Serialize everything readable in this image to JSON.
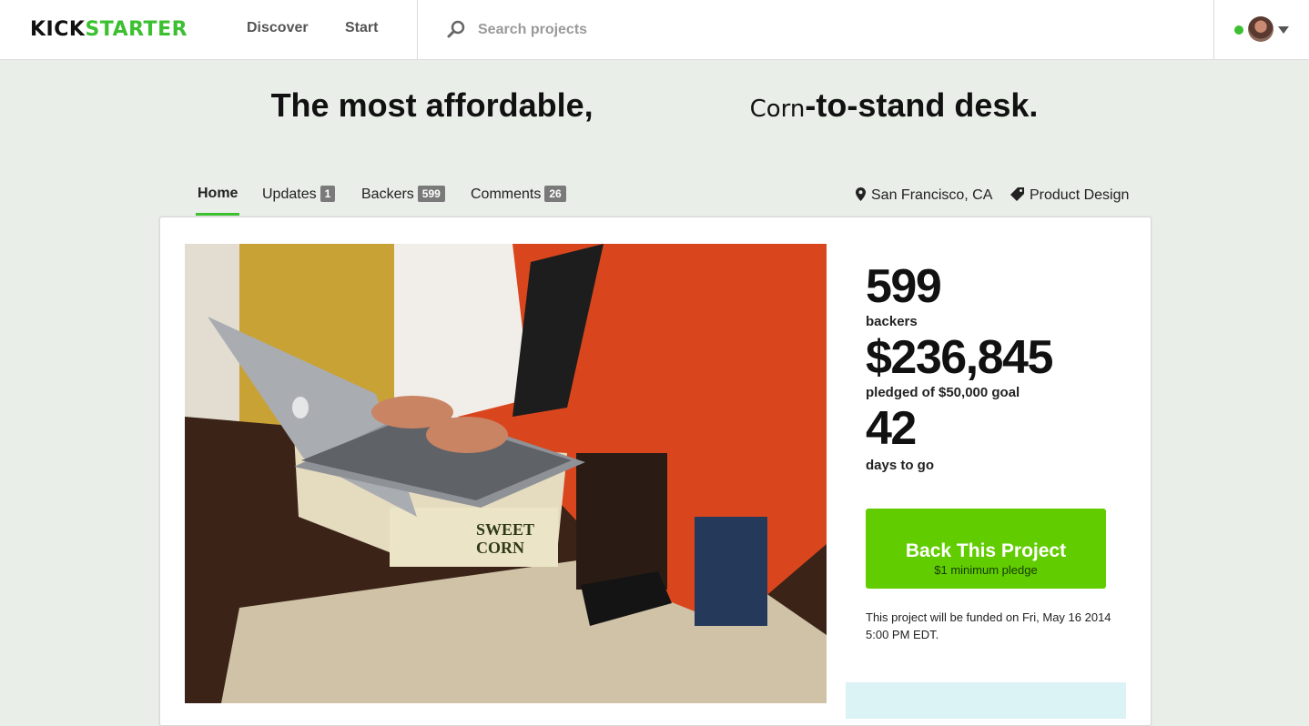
{
  "nav": {
    "logo_part1": "KICK",
    "logo_part2": "STARTER",
    "discover": "Discover",
    "start": "Start",
    "search_placeholder": "Search projects",
    "accent_color": "#3cc031"
  },
  "project": {
    "title_part1": "The most affordable,",
    "title_corn": "Corn",
    "title_part2": "-to-stand desk."
  },
  "tabs": [
    {
      "label": "Home",
      "count": ""
    },
    {
      "label": "Updates",
      "count": "1"
    },
    {
      "label": "Backers",
      "count": "599"
    },
    {
      "label": "Comments",
      "count": "26"
    }
  ],
  "meta": {
    "location": "San Francisco, CA",
    "category": "Product Design"
  },
  "stats": {
    "backers": "599",
    "backers_label": "backers",
    "pledged": "$236,845",
    "pledged_label": "pledged of $50,000 goal",
    "days": "42",
    "days_label": "days to go"
  },
  "cta": {
    "label": "Back This Project",
    "sublabel": "$1 minimum pledge",
    "color": "#61cc00"
  },
  "funding_note": "This project will be funded on Fri, May 16 2014 5:00 PM EDT.",
  "video": {
    "box_text1": "SWEET",
    "box_text2": "CORN"
  }
}
